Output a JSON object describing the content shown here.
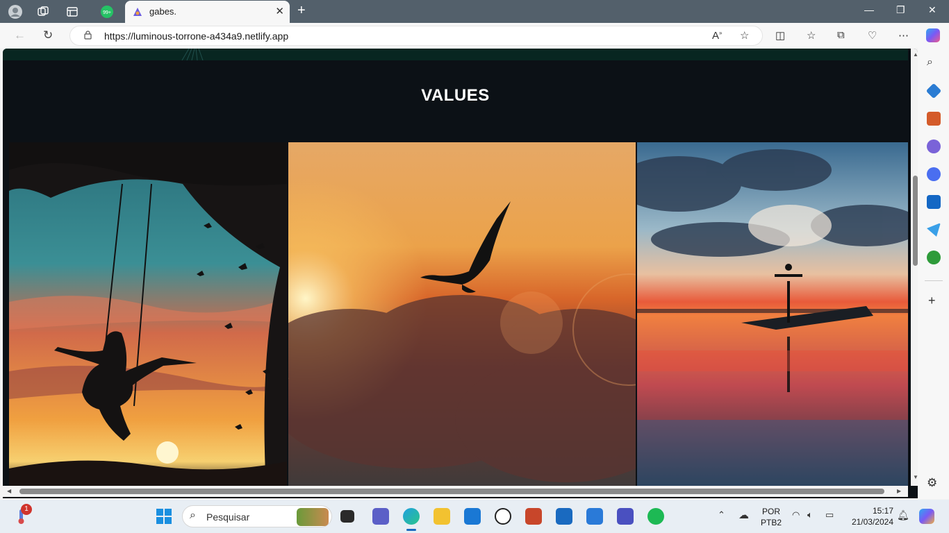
{
  "browser": {
    "tab_title": "gabes.",
    "tab_badge": "99+",
    "url": "https://luminous-torrone-a434a9.netlify.app"
  },
  "page": {
    "section_title": "VALUES"
  },
  "taskbar": {
    "search_placeholder": "Pesquisar",
    "notification_count": "1",
    "lang_top": "POR",
    "lang_bottom": "PTB2",
    "time": "15:17",
    "date": "21/03/2024"
  },
  "icons": [
    "profile-icon",
    "workspaces-icon",
    "tab-actions-icon",
    "whatsapp-icon",
    "close-icon",
    "new-tab-icon",
    "back-icon",
    "refresh-icon",
    "lock-icon",
    "read-aloud-icon",
    "favorite-icon",
    "split-screen-icon",
    "favorites-icon",
    "collections-icon",
    "browser-essentials-icon",
    "more-icon",
    "copilot-icon",
    "search-icon",
    "settings-icon"
  ]
}
